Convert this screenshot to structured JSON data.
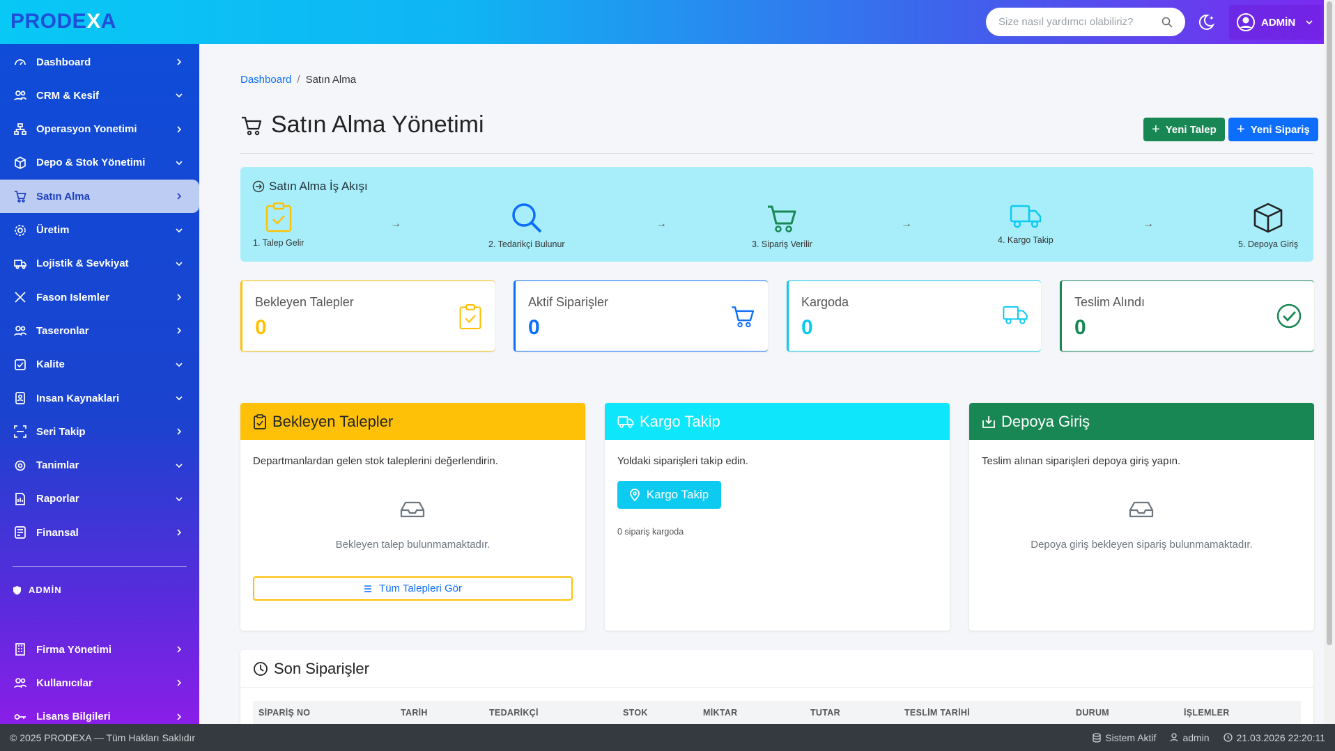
{
  "app": {
    "logo_prefix": "PRODE",
    "logo_x": "X",
    "logo_suffix": "A"
  },
  "header": {
    "search_placeholder": "Size nasıl yardımcı olabiliriz?",
    "user": "ADMİN"
  },
  "sidebar": {
    "items": [
      {
        "label": "Dashboard",
        "icon": "gauge-icon",
        "chevron": "right"
      },
      {
        "label": "CRM & Kesif",
        "icon": "users-icon",
        "chevron": "down"
      },
      {
        "label": "Operasyon Yonetimi",
        "icon": "sitemap-icon",
        "chevron": "right"
      },
      {
        "label": "Depo & Stok Yönetimi",
        "icon": "box-icon",
        "chevron": "down"
      },
      {
        "label": "Satın Alma",
        "icon": "cart-icon",
        "chevron": "right",
        "active": true
      },
      {
        "label": "Üretim",
        "icon": "gear-icon",
        "chevron": "down"
      },
      {
        "label": "Lojistik & Sevkiyat",
        "icon": "truck-icon",
        "chevron": "down"
      },
      {
        "label": "Fason Islemler",
        "icon": "tools-icon",
        "chevron": "right"
      },
      {
        "label": "Taseronlar",
        "icon": "users-icon",
        "chevron": "right"
      },
      {
        "label": "Kalite",
        "icon": "check-square-icon",
        "chevron": "down"
      },
      {
        "label": "Insan Kaynaklari",
        "icon": "id-badge-icon",
        "chevron": "down"
      },
      {
        "label": "Seri Takip",
        "icon": "scan-icon",
        "chevron": "right"
      },
      {
        "label": "Tanimlar",
        "icon": "cog-icon",
        "chevron": "down"
      },
      {
        "label": "Raporlar",
        "icon": "report-icon",
        "chevron": "down"
      },
      {
        "label": "Finansal",
        "icon": "finance-icon",
        "chevron": "right"
      }
    ],
    "admin_section": "ADMİN",
    "admin_items": [
      {
        "label": "Firma Yönetimi",
        "icon": "building-icon"
      },
      {
        "label": "Kullanıcılar",
        "icon": "users-icon"
      },
      {
        "label": "Lisans Bilgileri",
        "icon": "key-icon"
      }
    ]
  },
  "breadcrumb": {
    "home": "Dashboard",
    "current": "Satın Alma"
  },
  "page": {
    "title": "Satın Alma Yönetimi",
    "btn_new_request": "Yeni Talep",
    "btn_new_order": "Yeni Sipariş"
  },
  "workflow": {
    "title": "Satın Alma İş Akışı",
    "steps": [
      "1. Talep Gelir",
      "2. Tedarikçi Bulunur",
      "3. Sipariş Verilir",
      "4. Kargo Takip",
      "5. Depoya Giriş"
    ],
    "arrow": "→"
  },
  "stats": [
    {
      "label": "Bekleyen Talepler",
      "value": "0",
      "color": "#ffc107"
    },
    {
      "label": "Aktif Siparişler",
      "value": "0",
      "color": "#0d6efd"
    },
    {
      "label": "Kargoda",
      "value": "0",
      "color": "#0dcaf0"
    },
    {
      "label": "Teslim Alındı",
      "value": "0",
      "color": "#198754"
    }
  ],
  "cards": {
    "pending": {
      "title": "Bekleyen Talepler",
      "desc": "Departmanlardan gelen stok taleplerini değerlendirin.",
      "empty": "Bekleyen talep bulunmamaktadır.",
      "button": "Tüm Talepleri Gör"
    },
    "cargo": {
      "title": "Kargo Takip",
      "desc": "Yoldaki siparişleri takip edin.",
      "button": "Kargo Takip",
      "count_text": "0 sipariş kargoda"
    },
    "warehouse": {
      "title": "Depoya Giriş",
      "desc": "Teslim alınan siparişleri depoya giriş yapın.",
      "empty": "Depoya giriş bekleyen sipariş bulunmamaktadır."
    }
  },
  "orders": {
    "title": "Son Siparişler",
    "columns": [
      "SİPARİŞ NO",
      "TARİH",
      "TEDARİKÇİ",
      "STOK",
      "MİKTAR",
      "TUTAR",
      "TESLİM TARİHİ",
      "DURUM",
      "İŞLEMLER"
    ]
  },
  "footer": {
    "copyright": "© 2025 PRODEXA — Tüm Hakları Saklıdır",
    "status": "Sistem Aktif",
    "user": "admin",
    "datetime": "21.03.2026 22:20:11"
  }
}
